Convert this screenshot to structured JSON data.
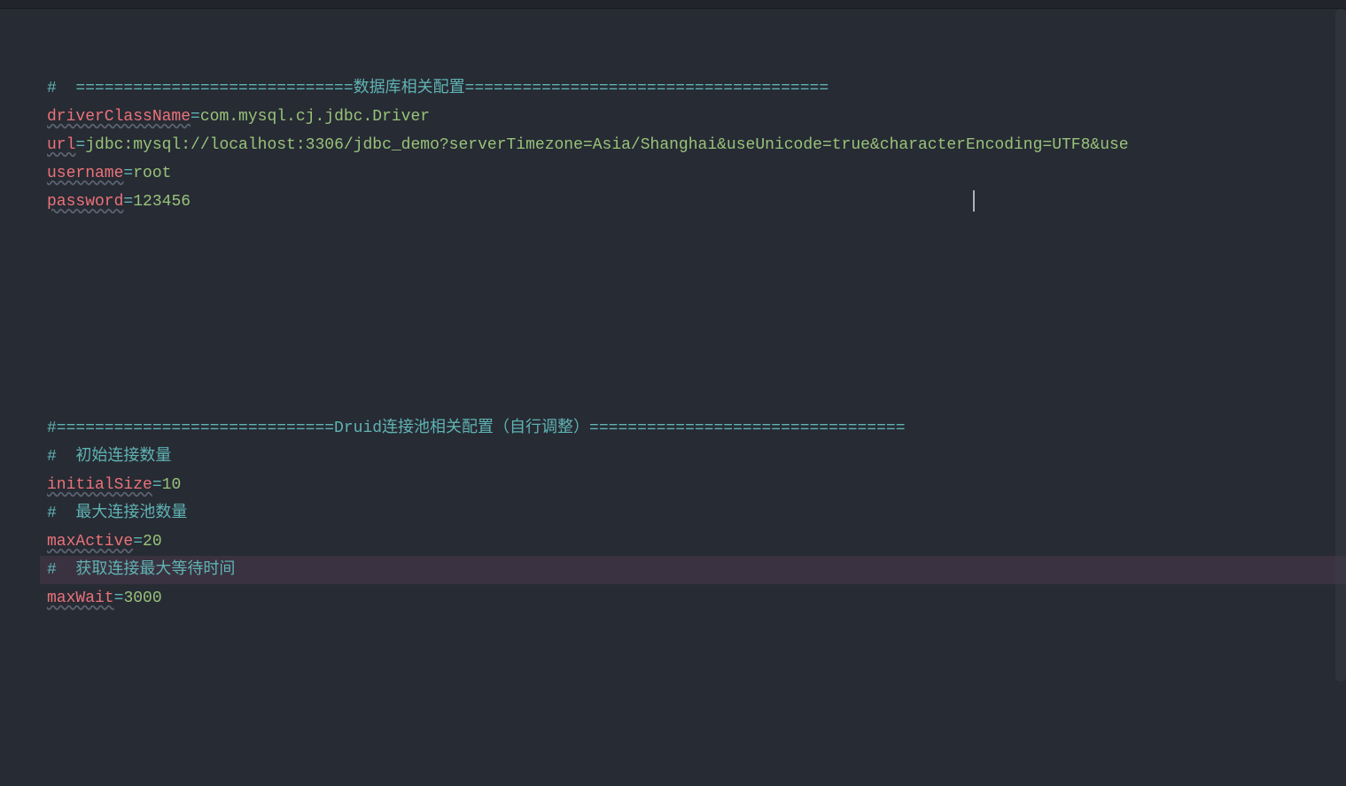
{
  "code": {
    "lines": [
      {
        "type": "comment",
        "text": "#  =============================数据库相关配置======================================"
      },
      {
        "type": "kv",
        "key": "driverClassName",
        "value": "com.mysql.cj.jdbc.Driver"
      },
      {
        "type": "kv",
        "key": "url",
        "value": "jdbc:mysql://localhost:3306/jdbc_demo?serverTimezone=Asia/Shanghai&useUnicode=true&characterEncoding=UTF8&use"
      },
      {
        "type": "kv",
        "key": "username",
        "value": "root"
      },
      {
        "type": "kv",
        "key": "password",
        "value": "123456"
      },
      {
        "type": "empty"
      },
      {
        "type": "empty"
      },
      {
        "type": "empty"
      },
      {
        "type": "empty"
      },
      {
        "type": "empty"
      },
      {
        "type": "empty"
      },
      {
        "type": "empty"
      },
      {
        "type": "comment",
        "text": "#=============================Druid连接池相关配置（自行调整）================================="
      },
      {
        "type": "comment",
        "text": "#  初始连接数量"
      },
      {
        "type": "kv",
        "key": "initialSize",
        "value": "10"
      },
      {
        "type": "comment",
        "text": "#  最大连接池数量"
      },
      {
        "type": "kv",
        "key": "maxActive",
        "value": "20"
      },
      {
        "type": "comment",
        "text": "#  获取连接最大等待时间",
        "highlighted": true
      },
      {
        "type": "kv",
        "key": "maxWait",
        "value": "3000"
      }
    ],
    "equals": "="
  }
}
